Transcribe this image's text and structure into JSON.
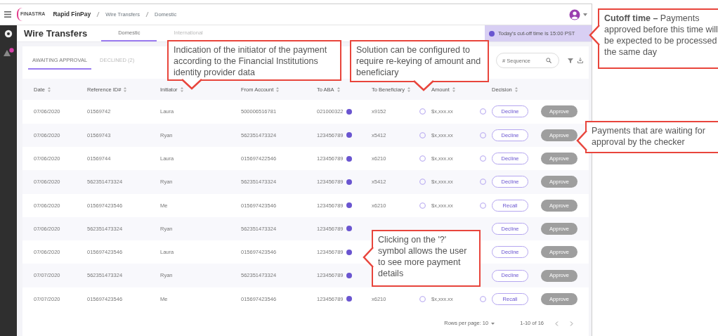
{
  "top_bar": {
    "logo": "FINASTRA",
    "breadcrumbs": [
      "Rapid FinPay",
      "Wire Transfers",
      "Domestic"
    ]
  },
  "page": {
    "title": "Wire Transfers",
    "tabs": [
      {
        "label": "Domestic",
        "selected": true
      },
      {
        "label": "International",
        "selected": false
      }
    ]
  },
  "cutoff_banner": "Today's cut-off time is 15:00 PST",
  "sub_tabs": [
    {
      "label": "AWAITING APPROVAL",
      "selected": true
    },
    {
      "label": "DECLINED (2)",
      "selected": false
    }
  ],
  "search": {
    "placeholder": "# Sequence"
  },
  "table": {
    "columns": [
      "Date",
      "Reference ID#",
      "Initiator",
      "From Account",
      "To ABA",
      "To Beneficiary",
      "Amount",
      "Decision"
    ],
    "rows": [
      {
        "date": "07/06/2020",
        "reference_id": "01569742",
        "initiator": "Laura",
        "from_account": "500006516781",
        "to_aba": "021000322",
        "to_beneficiary": "x9152",
        "amount": "$x,xxx.xx",
        "decision": "Decline",
        "approve": "Approve",
        "approve_disabled": true
      },
      {
        "date": "07/06/2020",
        "reference_id": "01569743",
        "initiator": "Ryan",
        "from_account": "562351473324",
        "to_aba": "123456789",
        "to_beneficiary": "x5412",
        "amount": "$x,xxx.xx",
        "decision": "Decline",
        "approve": "Approve",
        "approve_disabled": true
      },
      {
        "date": "07/06/2020",
        "reference_id": "01569744",
        "initiator": "Laura",
        "from_account": "015697422546",
        "to_aba": "123456789",
        "to_beneficiary": "x6210",
        "amount": "$x,xxx.xx",
        "decision": "Decline",
        "approve": "Approve",
        "approve_disabled": true
      },
      {
        "date": "07/06/2020",
        "reference_id": "562351473324",
        "initiator": "Ryan",
        "from_account": "562351473324",
        "to_aba": "123456789",
        "to_beneficiary": "x5412",
        "amount": "$x,xxx.xx",
        "decision": "Decline",
        "approve": "Approve",
        "approve_disabled": true
      },
      {
        "date": "07/06/2020",
        "reference_id": "015697423546",
        "initiator": "Me",
        "from_account": "015697423546",
        "to_aba": "123456789",
        "to_beneficiary": "x6210",
        "amount": "$x,xxx.xx",
        "decision": "Recall",
        "approve": "Approve",
        "approve_disabled": true
      },
      {
        "date": "07/06/2020",
        "reference_id": "562351473324",
        "initiator": "Ryan",
        "from_account": "562351473324",
        "to_aba": "123456789",
        "decision": "Decline",
        "approve": "Approve",
        "approve_disabled": true
      },
      {
        "date": "07/06/2020",
        "reference_id": "015697423546",
        "initiator": "Laura",
        "from_account": "015697423546",
        "to_aba": "123456789",
        "decision": "Decline",
        "approve": "Approve",
        "approve_disabled": true
      },
      {
        "date": "07/07/2020",
        "reference_id": "562351473324",
        "initiator": "Ryan",
        "from_account": "562351473324",
        "to_aba": "123456789",
        "decision": "Decline",
        "approve": "Approve",
        "approve_disabled": true
      },
      {
        "date": "07/07/2020",
        "reference_id": "015697423546",
        "initiator": "Me",
        "from_account": "015697423546",
        "to_aba": "123456789",
        "to_beneficiary": "x6210",
        "amount": "$x,xxx.xx",
        "decision": "Recall",
        "approve": "Approve",
        "approve_disabled": true
      }
    ]
  },
  "pagination": {
    "rows_per_page": "Rows per page: 10",
    "range": "1-10 of 16"
  },
  "callouts": [
    {
      "text": "Indication of the initiator of the payment according to the Financial Institutions identity provider data"
    },
    {
      "text": "Solution can be configured to require re-keying of amount and beneficiary"
    },
    {
      "text": "**Cutoff time –** Payments approved before this time will be expected to be processed the same day"
    },
    {
      "text": "Payments that are waiting for approval by the checker"
    },
    {
      "text": "Clicking on the '?' symbol allows the user to see more payment details"
    }
  ]
}
